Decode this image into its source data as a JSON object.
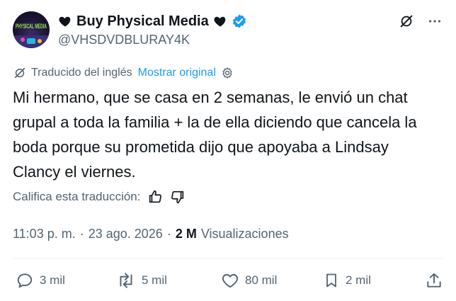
{
  "author": {
    "display_name": "Buy Physical Media",
    "handle": "@VHSDVDBLURAY4K",
    "avatar_text": "PHYSICAL MEDIA",
    "verified": true,
    "decor_icon": "black-heart-icon"
  },
  "translation": {
    "label": "Traducido del inglés",
    "show_original": "Mostrar original"
  },
  "tweet": {
    "text": "Mi hermano, que se casa en 2 semanas, le envió un chat grupal a toda la familia + la de ella diciendo que cancela la boda porque su prometida dijo que apoyaba a Lindsay Clancy el viernes."
  },
  "rating": {
    "label": "Califica esta traducción:"
  },
  "meta": {
    "time": "11:03 p. m.",
    "separator": "·",
    "date": "23 ago. 2026",
    "views_count": "2 M",
    "views_label": "Visualizaciones"
  },
  "actions": {
    "replies": "3 mil",
    "reposts": "5 mil",
    "likes": "80 mil",
    "bookmarks": "2 mil"
  },
  "colors": {
    "text": "#0f1419",
    "muted": "#536471",
    "link": "#1d9bf0",
    "verified": "#1d9bf0"
  }
}
